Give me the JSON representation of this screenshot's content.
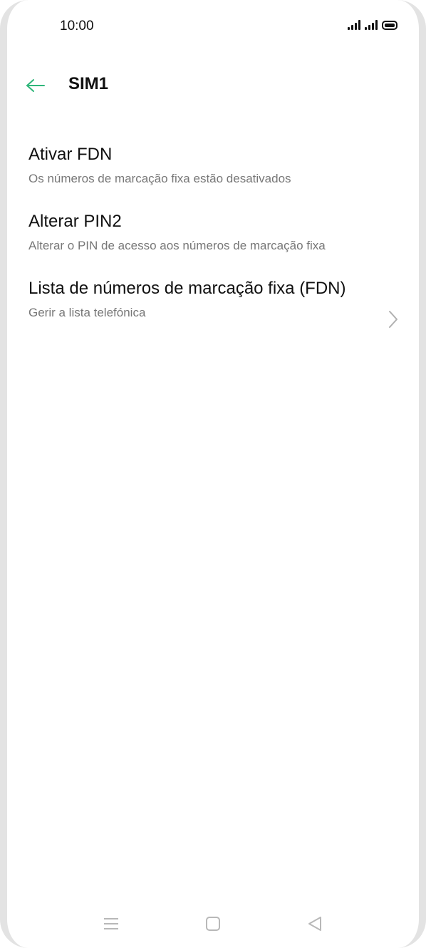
{
  "status_bar": {
    "time": "10:00"
  },
  "header": {
    "title": "SIM1",
    "back_icon": "arrow-left-icon",
    "accent_color": "#2fb67a"
  },
  "items": [
    {
      "title": "Ativar FDN",
      "subtitle": "Os números de marcação fixa estão desativados"
    },
    {
      "title": "Alterar PIN2",
      "subtitle": "Alterar o PIN de acesso aos números de marcação fixa"
    },
    {
      "title": "Lista de números de marcação fixa (FDN)",
      "subtitle": "Gerir a lista telefónica",
      "icon": "chevron-right-icon"
    }
  ],
  "nav_bar": {
    "icons": [
      "menu-icon",
      "home-icon",
      "back-triangle-icon"
    ]
  }
}
